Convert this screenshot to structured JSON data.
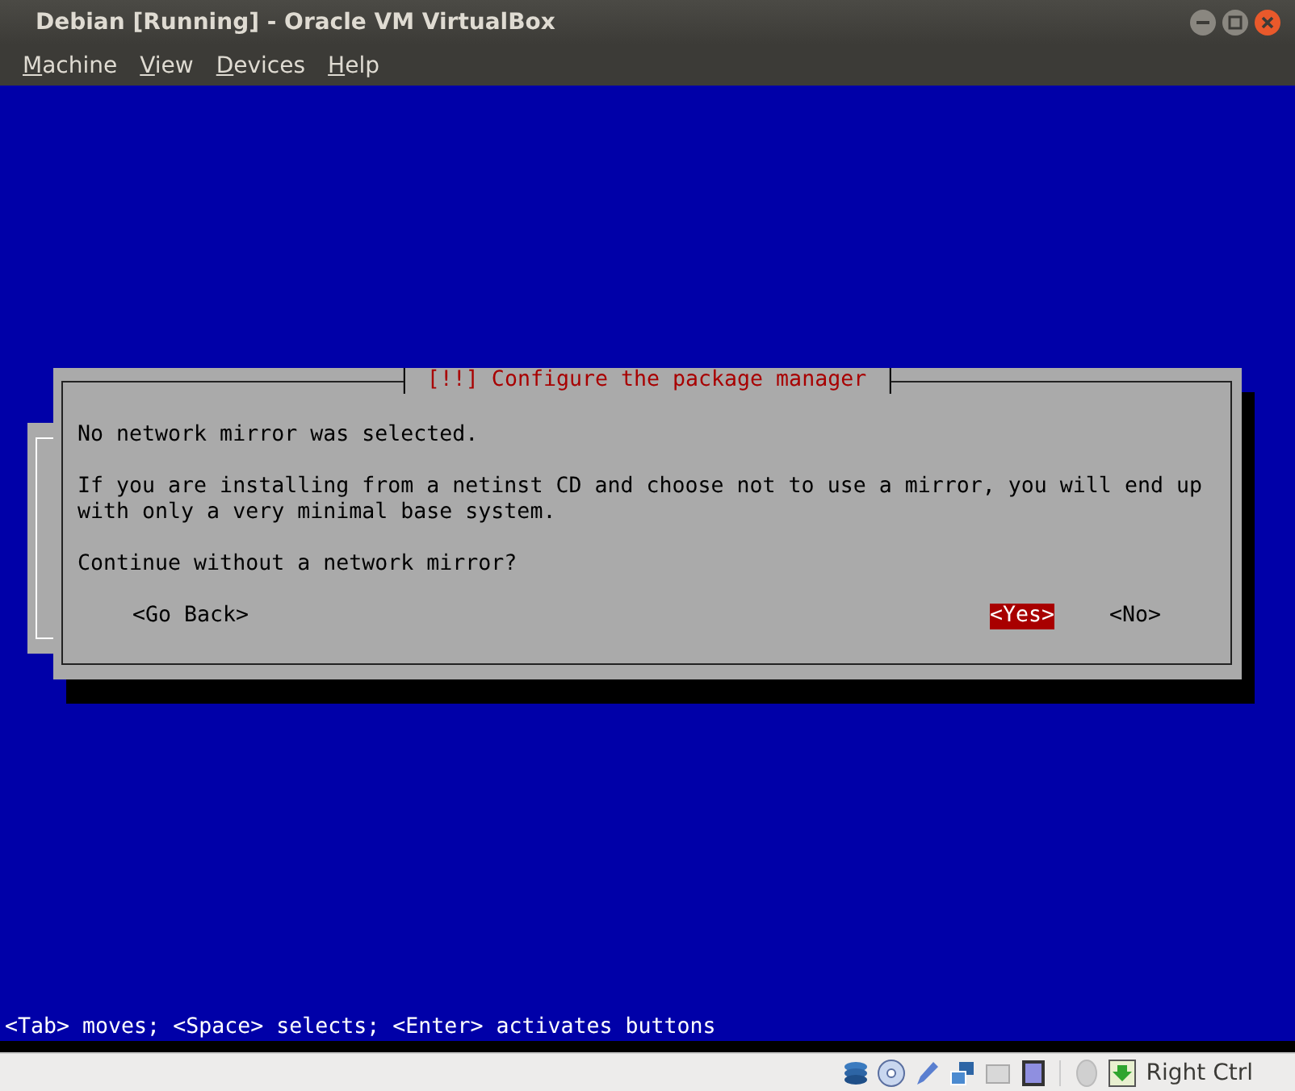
{
  "window": {
    "title": "Debian [Running] - Oracle VM VirtualBox"
  },
  "menu": [
    "Machine",
    "View",
    "Devices",
    "Help"
  ],
  "dialog": {
    "title": "[!!] Configure the package manager",
    "paragraphs": [
      "No network mirror was selected.",
      "If you are installing from a netinst CD and choose not to use a mirror, you will end up with only a very minimal base system.",
      "Continue without a network mirror?"
    ],
    "buttons": [
      {
        "label": "<Go Back>",
        "selected": false,
        "kind": "back"
      },
      {
        "label": "<Yes>",
        "selected": true,
        "kind": "answer"
      },
      {
        "label": "<No>",
        "selected": false,
        "kind": "answer"
      }
    ]
  },
  "help_line": "<Tab> moves; <Space> selects; <Enter> activates buttons",
  "status_bar": {
    "host_key": "Right Ctrl"
  }
}
